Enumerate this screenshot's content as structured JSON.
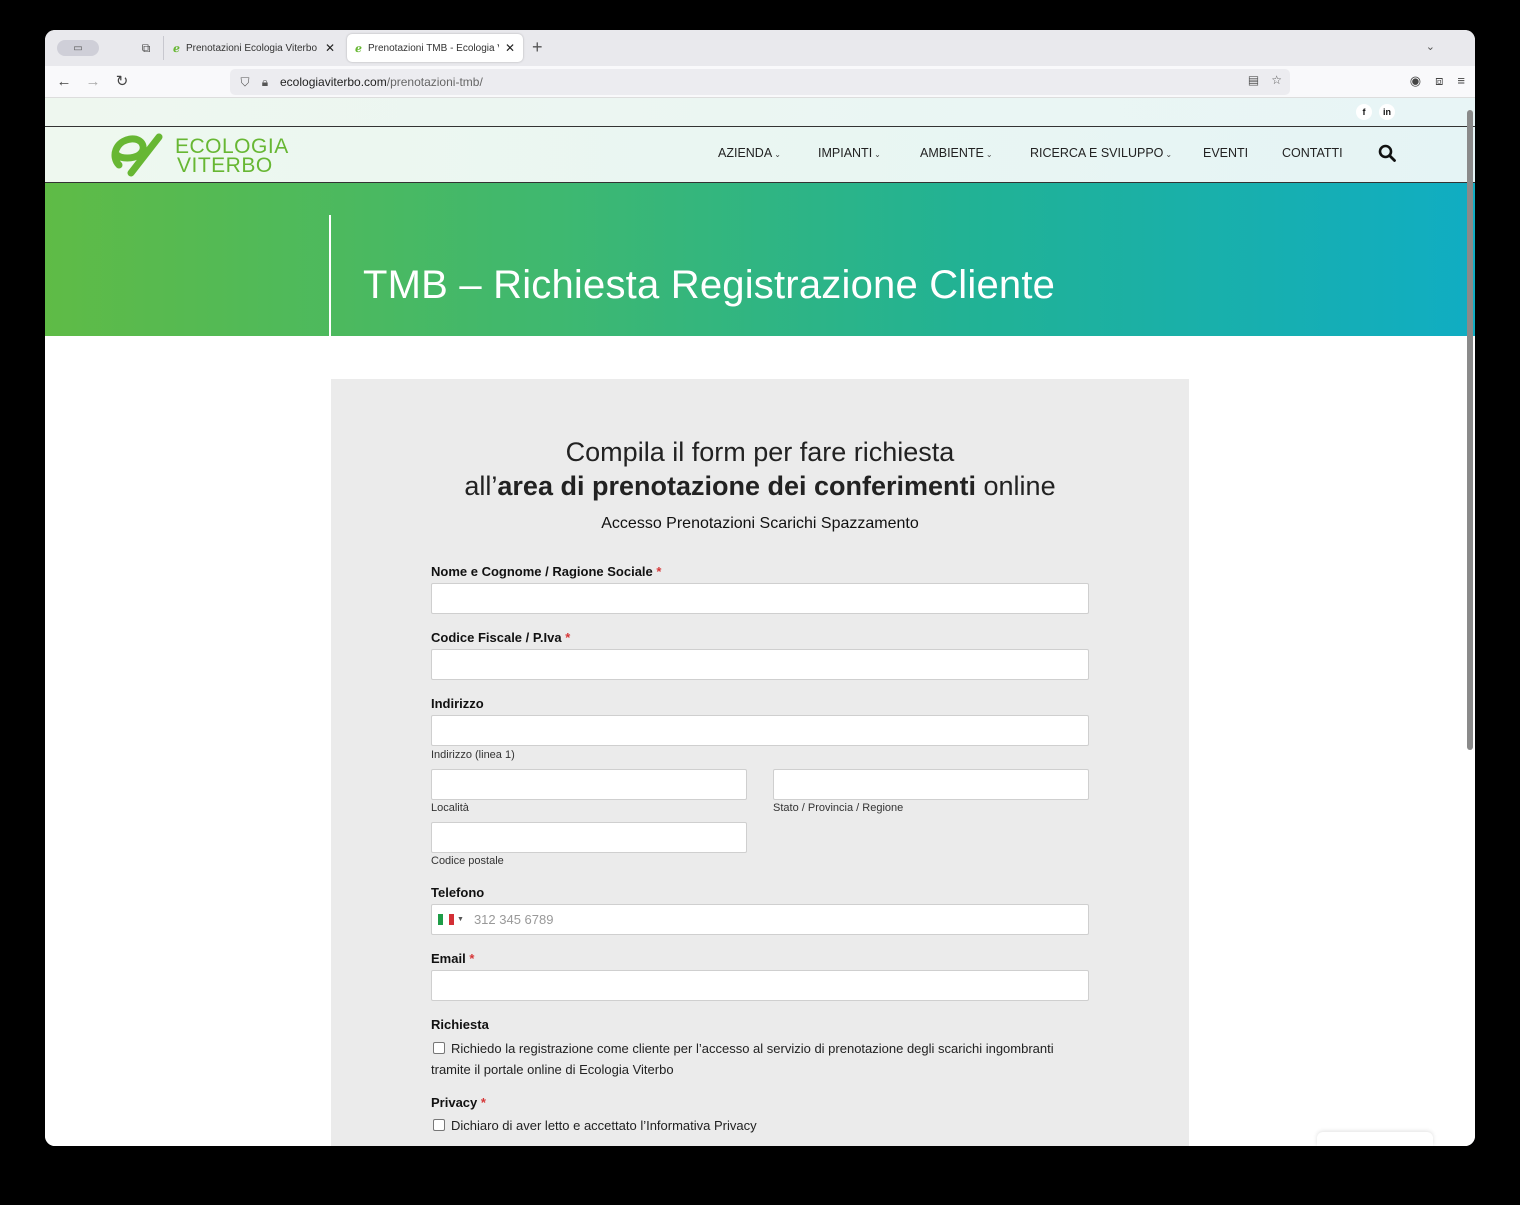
{
  "browser": {
    "tabs": [
      {
        "title": "Prenotazioni Ecologia Viterbo | E",
        "active": false
      },
      {
        "title": "Prenotazioni TMB - Ecologia Vit",
        "active": true
      }
    ],
    "url_host": "ecologiaviterbo.com",
    "url_path": "/prenotazioni-tmb/"
  },
  "site": {
    "logo_line1": "ECOLOGIA",
    "logo_line2": "VITERBO",
    "brand_color": "#67b733",
    "social": {
      "facebook": "f",
      "linkedin": "in"
    },
    "menu": [
      {
        "label": "AZIENDA",
        "dropdown": true
      },
      {
        "label": "IMPIANTI",
        "dropdown": true
      },
      {
        "label": "AMBIENTE",
        "dropdown": true
      },
      {
        "label": "RICERCA E SVILUPPO",
        "dropdown": true
      },
      {
        "label": "EVENTI",
        "dropdown": false
      },
      {
        "label": "CONTATTI",
        "dropdown": false
      }
    ]
  },
  "hero": {
    "title": "TMB – Richiesta Registrazione Cliente"
  },
  "form": {
    "heading_line1": "Compila il form per fare richiesta",
    "heading_pre": "all’",
    "heading_bold": "area di prenotazione dei conferimenti",
    "heading_post": " online",
    "subheading": "Accesso Prenotazioni Scarichi Spazzamento",
    "fields": {
      "name_label": "Nome e Cognome / Ragione Sociale",
      "cf_label": "Codice Fiscale / P.Iva",
      "address_label": "Indirizzo",
      "address_line1": "Indirizzo (linea 1)",
      "city": "Località",
      "state": "Stato / Provincia / Regione",
      "zip": "Codice postale",
      "phone_label": "Telefono",
      "phone_placeholder": "312 345 6789",
      "email_label": "Email",
      "request_label": "Richiesta",
      "request_text": "Richiedo la registrazione come cliente per l’accesso al servizio di prenotazione degli scarichi ingombranti tramite il portale online di Ecologia Viterbo",
      "privacy_label": "Privacy",
      "privacy_text": "Dichiaro di aver letto e accettato l’Informativa Privacy",
      "required_mark": "*"
    }
  }
}
